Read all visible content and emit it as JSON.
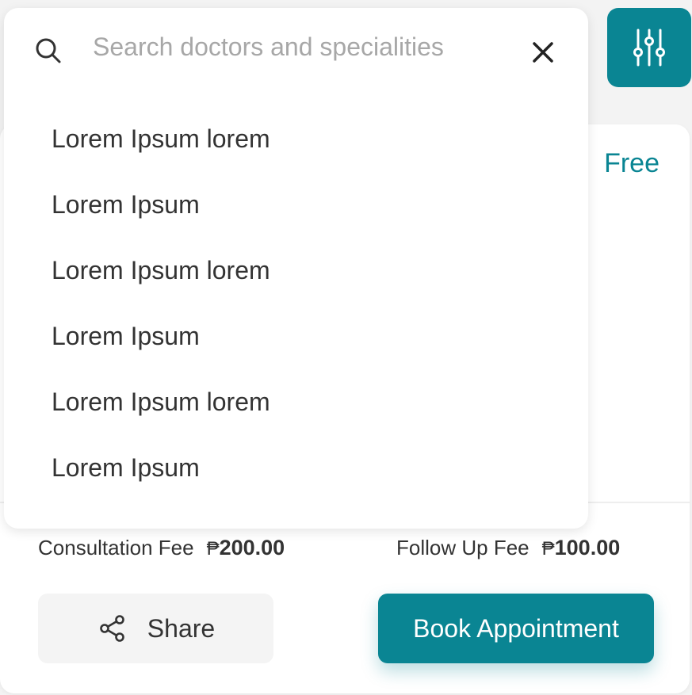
{
  "search": {
    "placeholder": "Search doctors and specialities",
    "value": "",
    "suggestions": [
      "Lorem Ipsum lorem",
      "Lorem Ipsum",
      "Lorem Ipsum lorem",
      "Lorem Ipsum",
      "Lorem Ipsum lorem",
      "Lorem Ipsum"
    ]
  },
  "doctor_card": {
    "free_label": "Free",
    "consultation_fee": {
      "label": "Consultation Fee",
      "currency": "₱",
      "amount": "200.00"
    },
    "follow_up_fee": {
      "label": "Follow Up Fee",
      "currency": "₱",
      "amount": "100.00"
    },
    "share_label": "Share",
    "book_label": "Book Appointment"
  },
  "icons": {
    "search": "search-icon",
    "clear": "close-icon",
    "filter": "sliders-icon",
    "share": "share-icon"
  },
  "colors": {
    "accent": "#0a8593",
    "placeholder": "#a7a7a7",
    "text": "#333333",
    "background": "#f3f3f3"
  }
}
